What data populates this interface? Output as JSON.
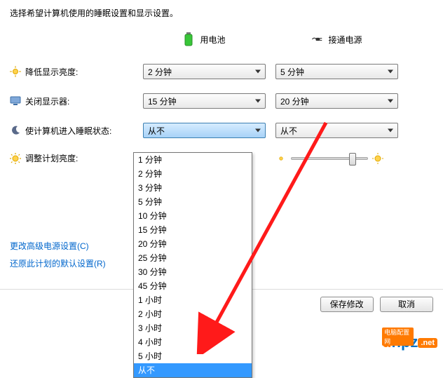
{
  "description": "选择希望计算机使用的睡眠设置和显示设置。",
  "column_headers": {
    "battery": "用电池",
    "plugged": "接通电源"
  },
  "rows": {
    "dim": {
      "label": "降低显示亮度:",
      "battery": "2 分钟",
      "plugged": "5 分钟"
    },
    "off": {
      "label": "关闭显示器:",
      "battery": "15 分钟",
      "plugged": "20 分钟"
    },
    "sleep": {
      "label": "使计算机进入睡眠状态:",
      "battery": "从不",
      "plugged": "从不"
    },
    "brightness": {
      "label": "调整计划亮度:"
    }
  },
  "dropdown_options": [
    "1 分钟",
    "2 分钟",
    "3 分钟",
    "5 分钟",
    "10 分钟",
    "15 分钟",
    "20 分钟",
    "25 分钟",
    "30 分钟",
    "45 分钟",
    "1 小时",
    "2 小时",
    "3 小时",
    "4 小时",
    "5 小时",
    "从不"
  ],
  "dropdown_selected": "从不",
  "links": {
    "advanced": "更改高级电源设置(C)",
    "restore": "还原此计划的默认设置(R)"
  },
  "buttons": {
    "save": "保存修改",
    "cancel": "取消"
  },
  "watermark": {
    "brand_d": "d",
    "brand_npz": "npz",
    "tld": ".net",
    "tag": "电脑配置网"
  }
}
